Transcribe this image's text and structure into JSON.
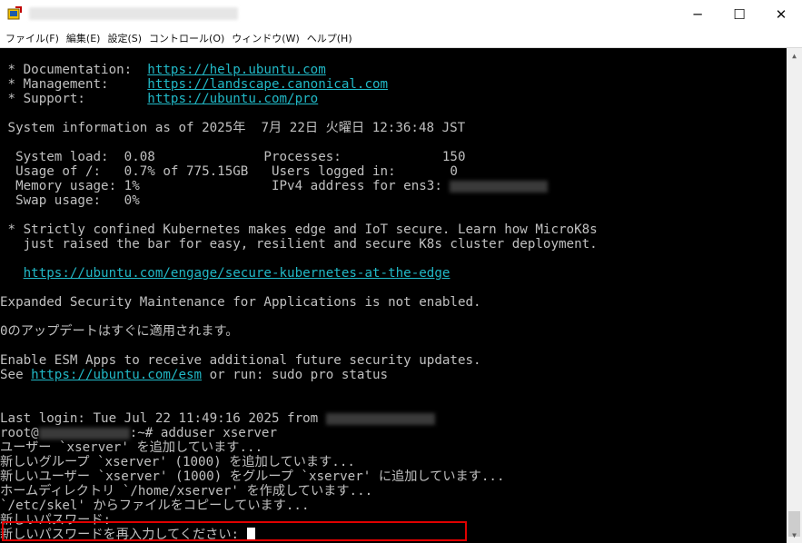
{
  "window": {
    "minimize_glyph": "─",
    "maximize_glyph": "☐",
    "close_glyph": "✕"
  },
  "menu": {
    "items": [
      "ファイル(F)",
      "編集(E)",
      "設定(S)",
      "コントロール(O)",
      "ウィンドウ(W)",
      "ヘルプ(H)"
    ]
  },
  "terminal": {
    "doc_label": " * Documentation:  ",
    "doc_url": "https://help.ubuntu.com",
    "mgmt_label": " * Management:     ",
    "mgmt_url": "https://landscape.canonical.com",
    "support_label": " * Support:        ",
    "support_url": "https://ubuntu.com/pro",
    "sysinfo": " System information as of 2025年  7月 22日 火曜日 12:36:48 JST",
    "sysload": "  System load:  0.08              Processes:             150",
    "usage": "  Usage of /:   0.7% of 775.15GB   Users logged in:       0",
    "memory": "  Memory usage: 1%                 IPv4 address for ens3: ",
    "swap": "  Swap usage:   0%",
    "k8s1": " * Strictly confined Kubernetes makes edge and IoT secure. Learn how MicroK8s",
    "k8s2": "   just raised the bar for easy, resilient and secure K8s cluster deployment.",
    "k8s_url": "https://ubuntu.com/engage/secure-kubernetes-at-the-edge",
    "esm": "Expanded Security Maintenance for Applications is not enabled.",
    "updates": "0のアップデートはすぐに適用されます。",
    "esm_apps": "Enable ESM Apps to receive additional future security updates.",
    "see": "See ",
    "esm_url": "https://ubuntu.com/esm",
    "see_tail": " or run: sudo pro status",
    "last_login": "Last login: Tue Jul 22 11:49:16 2025 from ",
    "prompt_user": "root@",
    "prompt_cmd": ":~# adduser xserver",
    "out1": "ユーザー `xserver' を追加しています...",
    "out2": "新しいグループ `xserver' (1000) を追加しています...",
    "out3": "新しいユーザー `xserver' (1000) をグループ `xserver' に追加しています...",
    "out4": "ホームディレクトリ `/home/xserver' を作成しています...",
    "out5": "`/etc/skel' からファイルをコピーしています...",
    "out6": "新しいパスワード:",
    "out7": "新しいパスワードを再入力してください: "
  }
}
